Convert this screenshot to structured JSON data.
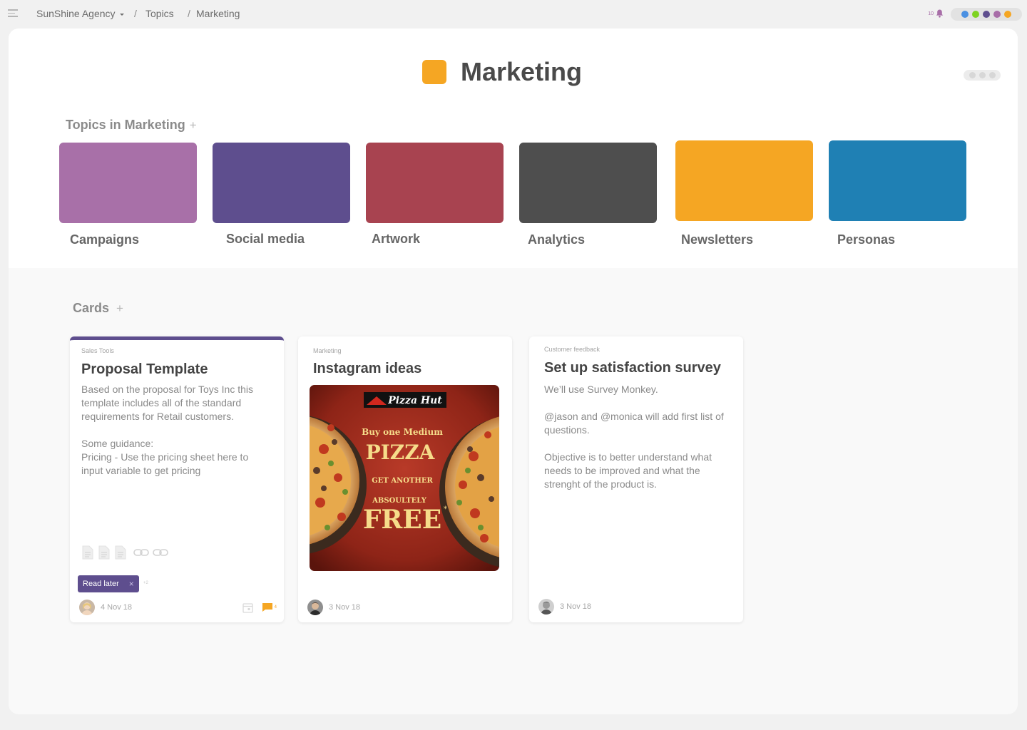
{
  "breadcrumb": {
    "workspace": "SunShine Agency",
    "topics": "Topics",
    "current": "Marketing",
    "separator": "/"
  },
  "notifications": {
    "count": "10",
    "icon": "bell-icon",
    "color": "#a86ea8"
  },
  "members": {
    "colors": [
      "#4a90e2",
      "#7ed321",
      "#5e4e8e",
      "#a86ea8",
      "#f5a623"
    ]
  },
  "page": {
    "title": "Marketing",
    "title_color": "#f5a623"
  },
  "topics_section": {
    "title": "Topics in Marketing",
    "add": "+",
    "items": [
      {
        "label": "Campaigns",
        "color": "#a870a8"
      },
      {
        "label": "Social media",
        "color": "#5e4e8e"
      },
      {
        "label": "Artwork",
        "color": "#a84350"
      },
      {
        "label": "Analytics",
        "color": "#4e4e4e"
      },
      {
        "label": "Newsletters",
        "color": "#f5a623"
      },
      {
        "label": "Personas",
        "color": "#1f80b4"
      }
    ]
  },
  "cards_section": {
    "title": "Cards",
    "add": "+",
    "cards": [
      {
        "category": "Sales Tools",
        "title": "Proposal Template",
        "body": [
          "Based on the proposal for Toys Inc this template includes all of the standard requirements for Retail customers.",
          "",
          "Some guidance:",
          "Pricing - Use the pricing sheet here to input variable to get pricing"
        ],
        "tag": "Read later",
        "tag_remove": "×",
        "tag_more": "+2",
        "comment_count": "4",
        "date": "4 Nov 18",
        "accent": "#5e4e8e"
      },
      {
        "category": "Marketing",
        "title": "Instagram ideas",
        "image": {
          "brand": "Pizza Hut",
          "line1": "Buy one Medium",
          "line2": "PIZZA",
          "line3": "GET ANOTHER",
          "line4": "ABSOULTELY",
          "line5": "FREE",
          "asterisk": "*"
        },
        "date": "3 Nov 18"
      },
      {
        "category": "Customer feedback",
        "title": "Set up satisfaction survey",
        "body": [
          "We’ll use Survey Monkey.",
          "",
          "@jason and @monica will add first list of questions.",
          "",
          "Objective is to better understand what needs to be improved and what the strenght of the product is."
        ],
        "date": "3 Nov 18"
      }
    ]
  }
}
